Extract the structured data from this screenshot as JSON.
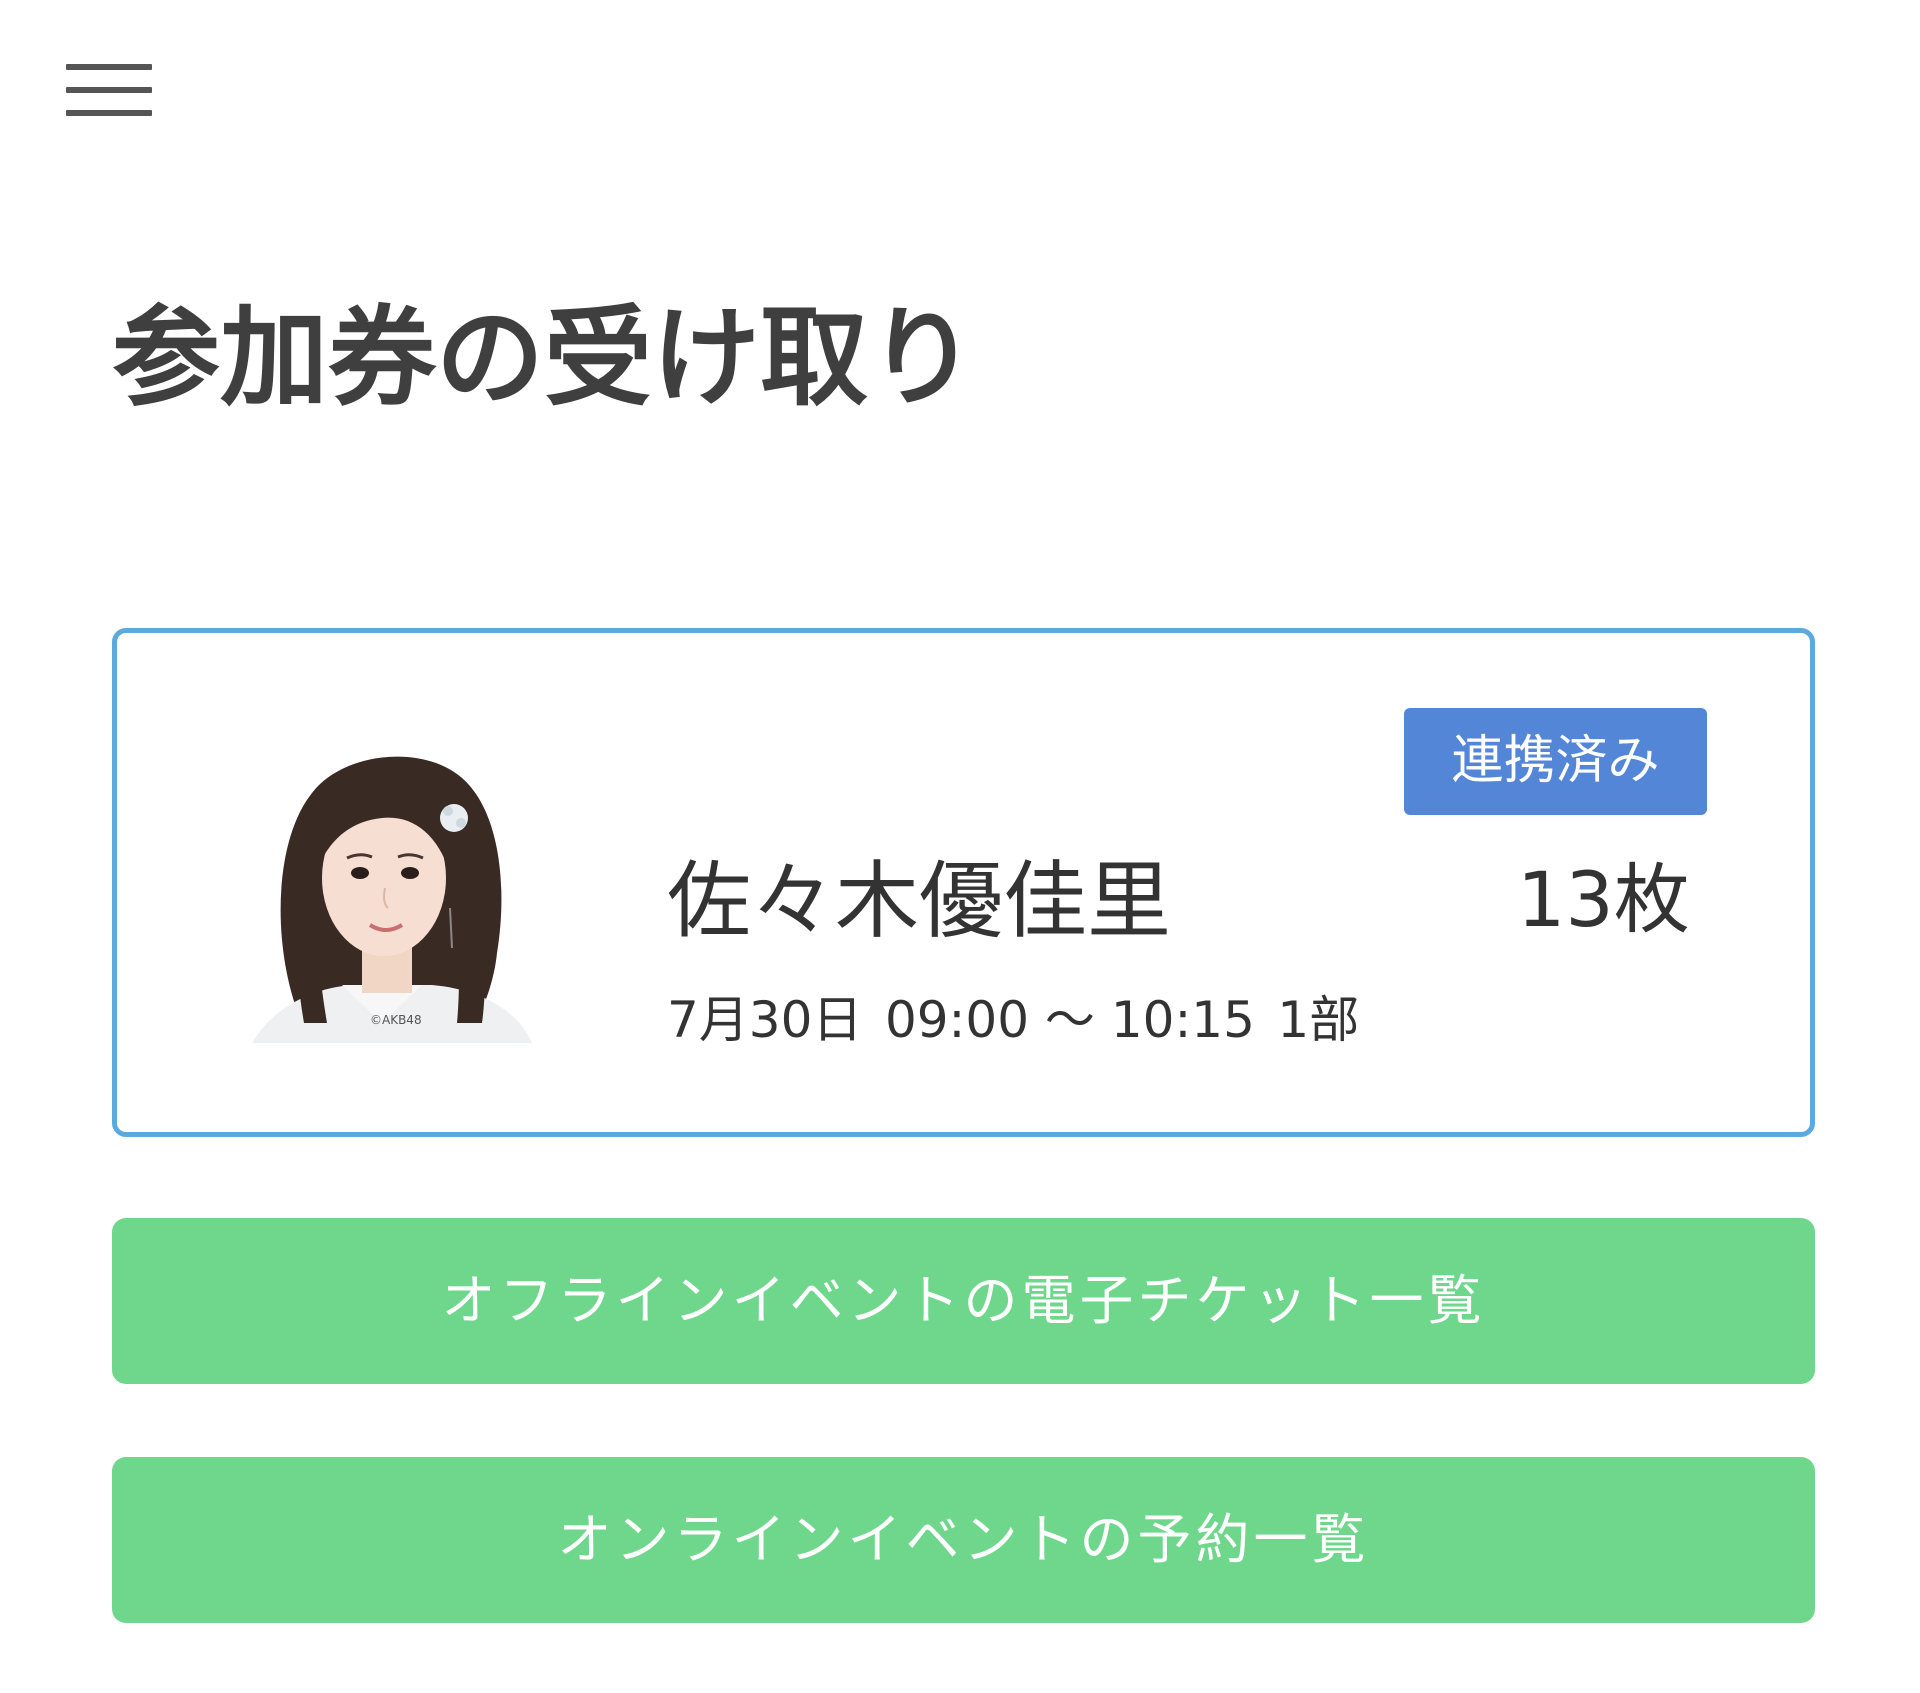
{
  "header": {
    "menu_icon": "hamburger-menu-icon"
  },
  "page": {
    "title": "参加券の受け取り"
  },
  "member_card": {
    "photo_copyright": "©AKB48",
    "name": "佐々木優佳里",
    "date": "7月30日",
    "time_range": "09:00 ～ 10:15",
    "session": "1部",
    "status_badge": "連携済み",
    "ticket_count": "13枚",
    "colors": {
      "border": "#5aaae0",
      "badge": "#5486d8"
    }
  },
  "actions": {
    "offline_tickets_label": "オフラインイベントの電子チケット一覧",
    "online_reservations_label": "オンラインイベントの予約一覧",
    "button_color": "#6fd78b"
  }
}
